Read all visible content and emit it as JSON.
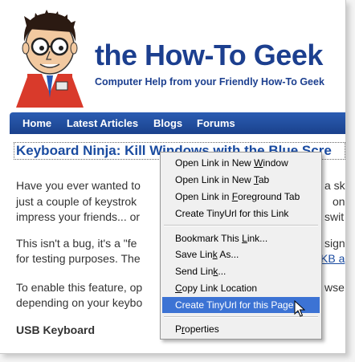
{
  "site": {
    "title": "the How-To Geek",
    "tagline": "Computer Help from your Friendly How-To Geek"
  },
  "nav": {
    "items": [
      {
        "label": "Home"
      },
      {
        "label": "Latest Articles"
      },
      {
        "label": "Blogs"
      },
      {
        "label": "Forums"
      }
    ]
  },
  "article": {
    "title": "Keyboard Ninja: Kill Windows with the Blue Scre",
    "p1": [
      "Have you ever wanted to",
      "a sk",
      "just a couple of keystrok",
      "one",
      "impress your friends... or",
      "swit"
    ],
    "p2": [
      "This isn't a bug, it's a \"fe",
      "signe",
      "for testing purposes. The",
      "KB a"
    ],
    "p3": [
      "To enable this feature, op",
      "wse",
      "depending on your keybo"
    ],
    "usb_heading": "USB Keyboard"
  },
  "context_menu": {
    "items": [
      {
        "label": "Open Link in New ",
        "key": "W",
        "rest": "indow"
      },
      {
        "label": "Open Link in New ",
        "key": "T",
        "rest": "ab"
      },
      {
        "label": "Open Link in ",
        "key": "F",
        "rest": "oreground Tab"
      },
      {
        "label": "Create TinyUrl for this Link",
        "key": "",
        "rest": ""
      },
      {
        "label": "Bookmark This ",
        "key": "L",
        "rest": "ink..."
      },
      {
        "label": "Save Lin",
        "key": "k",
        "rest": " As..."
      },
      {
        "label": "Send Lin",
        "key": "k",
        "rest": "..."
      },
      {
        "label": "",
        "key": "C",
        "rest": "opy Link Location"
      },
      {
        "label": "Create TinyUrl for this Page",
        "key": "",
        "rest": ""
      },
      {
        "label": "P",
        "key": "r",
        "rest": "operties"
      }
    ],
    "highlighted_index": 8
  },
  "colors": {
    "brand_blue": "#1c3f8f",
    "nav_blue": "#1a418c",
    "link_blue": "#1a4ba0",
    "menu_highlight": "#3c73d4"
  }
}
